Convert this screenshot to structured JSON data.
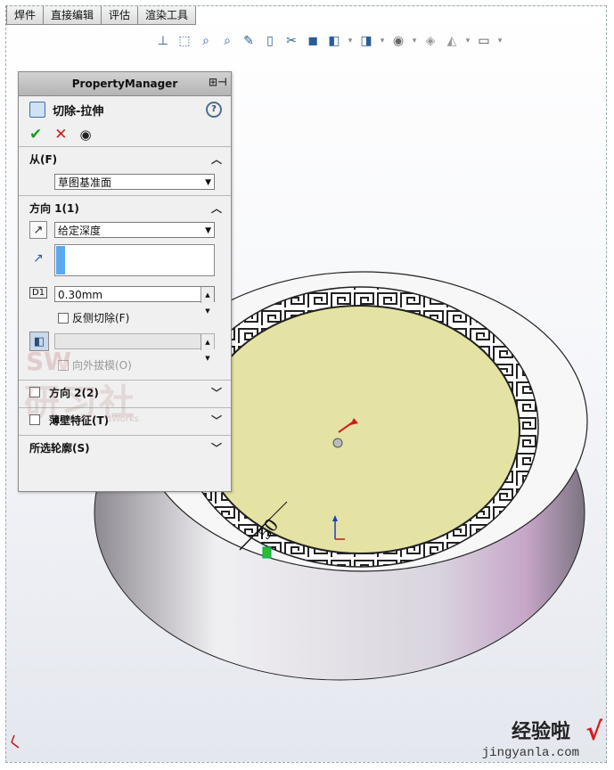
{
  "tabs": [
    "焊件",
    "直接编辑",
    "评估",
    "渲染工具"
  ],
  "toolbar_icons": [
    "normal-to-icon",
    "zoom-to-fit-icon",
    "zoom-area-icon",
    "zoom-previous-icon",
    "section-view-icon",
    "view-orientation-icon",
    "display-style-icon",
    "hide-show-icon",
    "edit-appearance-icon",
    "apply-scene-icon",
    "view-settings-icon"
  ],
  "pm": {
    "header": "PropertyManager",
    "feature_title": "切除-拉伸",
    "help": "?",
    "from": {
      "label": "从(F)",
      "value": "草图基准面"
    },
    "direction1": {
      "label": "方向 1(1)",
      "end_condition": "给定深度",
      "depth": "0.30mm",
      "flip_label": "反侧切除(F)",
      "draft_outward_label": "向外拔模(O)"
    },
    "direction2": {
      "label": "方向 2(2)"
    },
    "thin": {
      "label": "薄壁特征(T)"
    },
    "contours": {
      "label": "所选轮廓(S)"
    }
  },
  "dimension": "50",
  "watermark": {
    "line1": "SW",
    "line2": "研习社",
    "line3": "dWorks"
  },
  "brand": {
    "name": "经验啦",
    "url": "jingyanla.com"
  },
  "colors": {
    "face": "#e5e3a4",
    "ring": "#f2f2f2",
    "accent": "#1f5fa8"
  }
}
